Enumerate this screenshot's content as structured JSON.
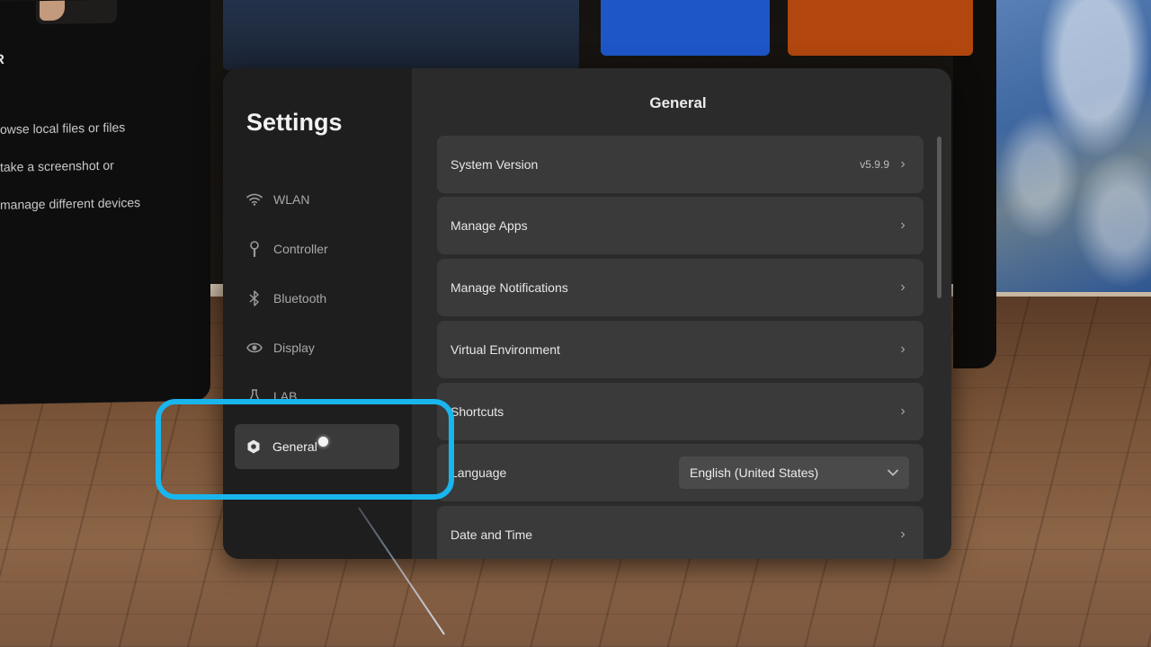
{
  "background_panel": {
    "heading": "R",
    "lines": [
      "owse local files or files",
      "take a screenshot or",
      "manage different devices"
    ]
  },
  "settings": {
    "title": "Settings",
    "nav": [
      {
        "label": "WLAN",
        "icon": "wifi-icon",
        "active": false
      },
      {
        "label": "Controller",
        "icon": "controller-icon",
        "active": false
      },
      {
        "label": "Bluetooth",
        "icon": "bluetooth-icon",
        "active": false
      },
      {
        "label": "Display",
        "icon": "eye-icon",
        "active": false
      },
      {
        "label": "LAB",
        "icon": "flask-icon",
        "active": false
      },
      {
        "label": "General",
        "icon": "gear-icon",
        "active": true
      }
    ]
  },
  "general": {
    "title": "General",
    "rows": [
      {
        "label": "System Version",
        "value": "v5.9.9",
        "type": "link"
      },
      {
        "label": "Manage Apps",
        "type": "link"
      },
      {
        "label": "Manage Notifications",
        "type": "link"
      },
      {
        "label": "Virtual Environment",
        "type": "link"
      },
      {
        "label": "Shortcuts",
        "type": "link"
      },
      {
        "label": "Language",
        "type": "dropdown",
        "value": "English (United States)"
      },
      {
        "label": "Date and Time",
        "type": "link"
      }
    ]
  },
  "colors": {
    "highlight": "#19b6ee",
    "panel": "#2b2b2c",
    "row": "#3a3a3b"
  }
}
